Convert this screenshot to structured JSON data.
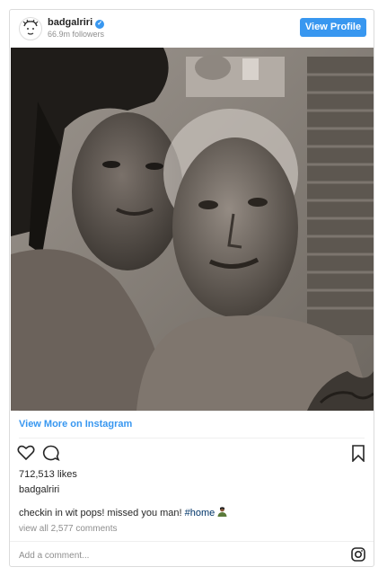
{
  "header": {
    "username": "badgalriri",
    "followers": "66.9m followers",
    "view_profile_label": "View Profile",
    "avatar_icon": "avatar-illustration-icon",
    "verified_icon": "verified-badge-icon"
  },
  "post": {
    "view_more_label": "View More on Instagram",
    "likes": "712,513 likes",
    "caption_user": "badgalriri",
    "caption_text": "checkin in wit pops! missed you man!",
    "hashtag": "#home",
    "comments_link": "view all 2,577 comments",
    "add_comment_placeholder": "Add a comment..."
  },
  "icons": {
    "like": "heart-icon",
    "comment": "comment-bubble-icon",
    "save": "bookmark-icon",
    "instagram": "instagram-logo-icon"
  },
  "colors": {
    "accent": "#3897f0",
    "hashtag": "#003569",
    "muted": "#8e8e8e",
    "text": "#262626"
  }
}
